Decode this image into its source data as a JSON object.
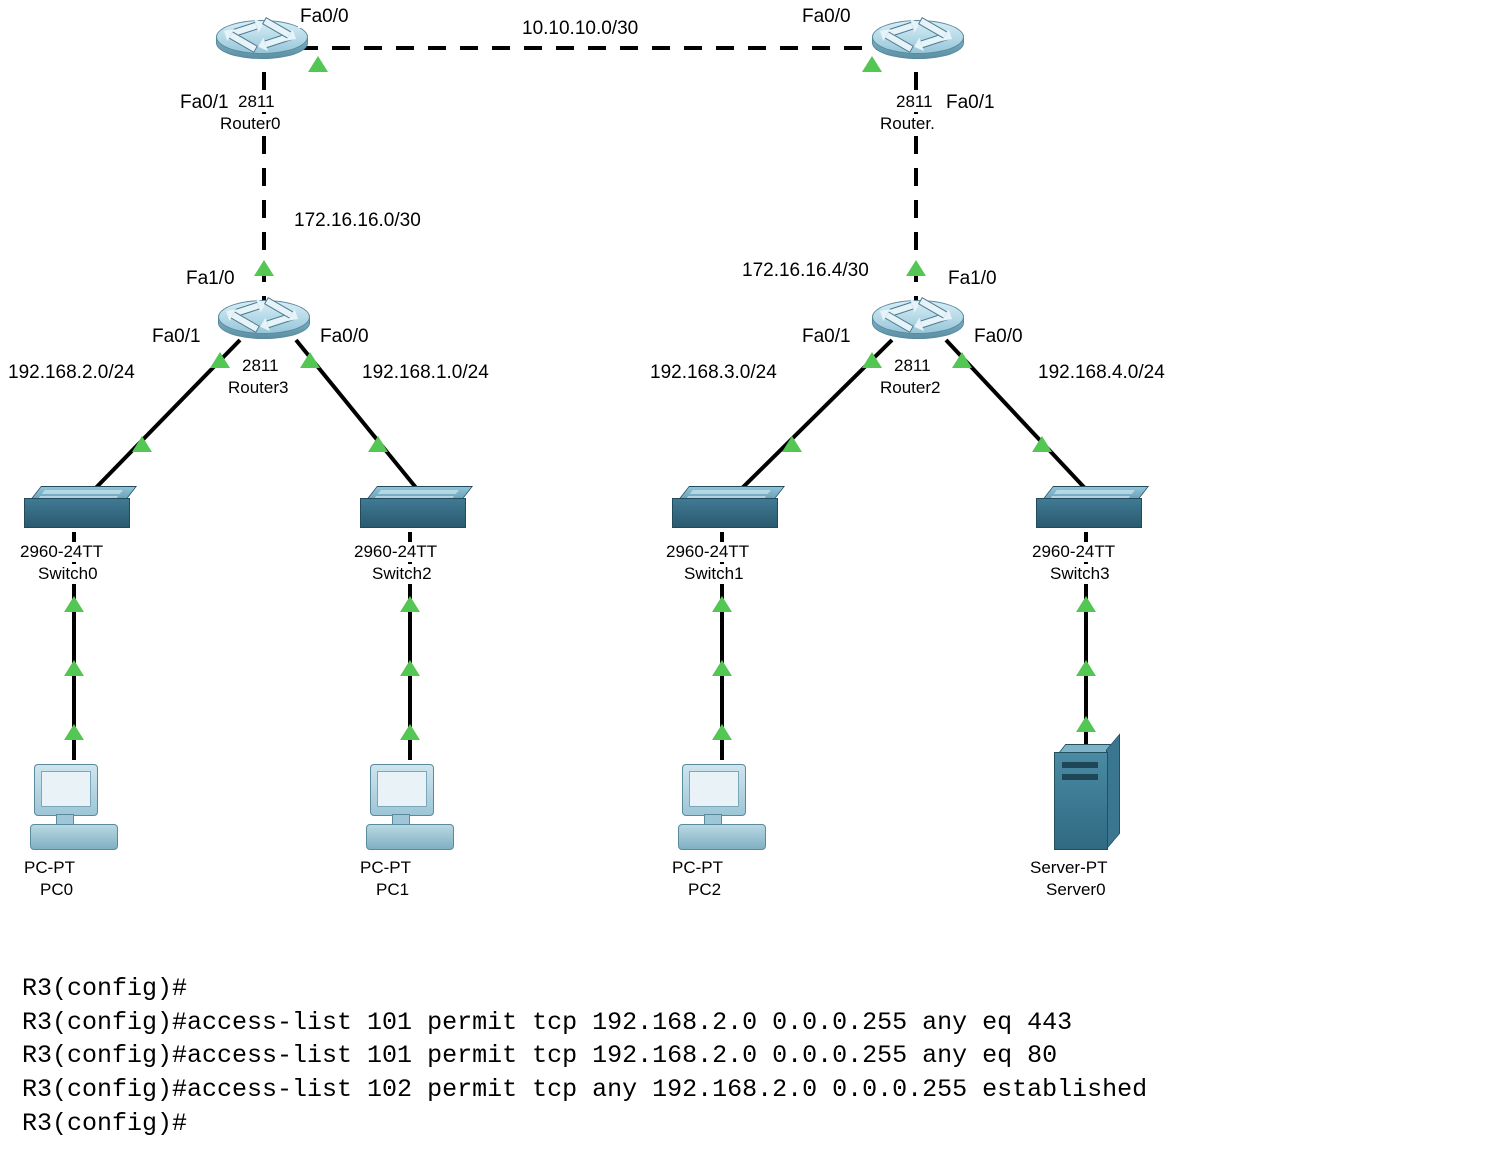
{
  "topology": {
    "subnets": {
      "r0_r1": "10.10.10.0/30",
      "r0_r3": "172.16.16.0/30",
      "r1_r2": "172.16.16.4/30",
      "r3_left": "192.168.2.0/24",
      "r3_right": "192.168.1.0/24",
      "r2_left": "192.168.3.0/24",
      "r2_right": "192.168.4.0/24"
    },
    "interfaces": {
      "r0_fa00": "Fa0/0",
      "r0_fa01": "Fa0/1",
      "r1_fa00": "Fa0/0",
      "r1_fa01": "Fa0/1",
      "r3_fa10": "Fa1/0",
      "r3_fa00": "Fa0/0",
      "r3_fa01": "Fa0/1",
      "r2_fa10": "Fa1/0",
      "r2_fa00": "Fa0/0",
      "r2_fa01": "Fa0/1"
    },
    "devices": {
      "router0": {
        "model": "2811",
        "name": "Router0"
      },
      "router1": {
        "model": "2811",
        "name": "Router."
      },
      "router2": {
        "model": "2811",
        "name": "Router2"
      },
      "router3": {
        "model": "2811",
        "name": "Router3"
      },
      "switch0": {
        "model": "2960-24TT",
        "name": "Switch0"
      },
      "switch1": {
        "model": "2960-24TT",
        "name": "Switch1"
      },
      "switch2": {
        "model": "2960-24TT",
        "name": "Switch2"
      },
      "switch3": {
        "model": "2960-24TT",
        "name": "Switch3"
      },
      "pc0": {
        "model": "PC-PT",
        "name": "PC0"
      },
      "pc1": {
        "model": "PC-PT",
        "name": "PC1"
      },
      "pc2": {
        "model": "PC-PT",
        "name": "PC2"
      },
      "server0": {
        "model": "Server-PT",
        "name": "Server0"
      }
    }
  },
  "terminal": {
    "l1": "R3(config)#",
    "l2": "R3(config)#access-list 101 permit tcp 192.168.2.0 0.0.0.255 any eq 443",
    "l3": "R3(config)#access-list 101 permit tcp 192.168.2.0 0.0.0.255 any eq 80",
    "l4": "R3(config)#access-list 102 permit tcp any 192.168.2.0 0.0.0.255 established",
    "l5": "R3(config)#"
  }
}
